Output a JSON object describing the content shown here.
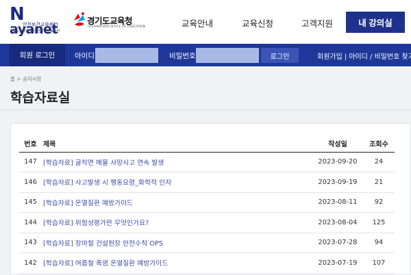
{
  "header": {
    "logo_main": "ayanet",
    "logo_n": "N",
    "logo_sub1": "안전보건교육센터",
    "logo_sub2": "고용노동부지정 안전보건교육기관",
    "gg_name": "경기도교육청",
    "gg_eng": "GYEONGGIDO OFFICE OF EDUCATION",
    "nav": [
      "교육안내",
      "교육신청",
      "고객지원"
    ],
    "my_class": "내 강의실"
  },
  "login": {
    "label": "회원 로그인",
    "id_label": "아이디",
    "pw_label": "비밀번호",
    "button": "로그인",
    "join": "회원가입",
    "find": "아이디 / 비밀번호 찾기",
    "sep": "|"
  },
  "breadcrumb": "홈 > 공지사항",
  "page_title": "학습자료실",
  "table": {
    "headers": [
      "번호",
      "제목",
      "작성일",
      "조회수"
    ],
    "rows": [
      {
        "no": "147",
        "title": "[학습자료] 굴착면 매몰 사망사고 연속 발생",
        "date": "2023-09-20",
        "views": "24"
      },
      {
        "no": "146",
        "title": "[학습자료] 사고발생 시 행동요령_화학적 인자",
        "date": "2023-09-19",
        "views": "21"
      },
      {
        "no": "145",
        "title": "[학습자료] 온열질환 예방가이드",
        "date": "2023-08-11",
        "views": "92"
      },
      {
        "no": "144",
        "title": "[학습자료] 위험성평가란 무엇인가요?",
        "date": "2023-08-04",
        "views": "125"
      },
      {
        "no": "143",
        "title": "[학습자료] 장마철 건설현장 안전수칙 OPS",
        "date": "2023-07-28",
        "views": "94"
      },
      {
        "no": "142",
        "title": "[학습자료] 여름철 폭염 온열질환 예방가이드",
        "date": "2023-07-19",
        "views": "107"
      }
    ]
  },
  "colors": {
    "brand_navy": "#1e318b",
    "login_bar": "#1e3799",
    "link": "#3a4aa6"
  }
}
